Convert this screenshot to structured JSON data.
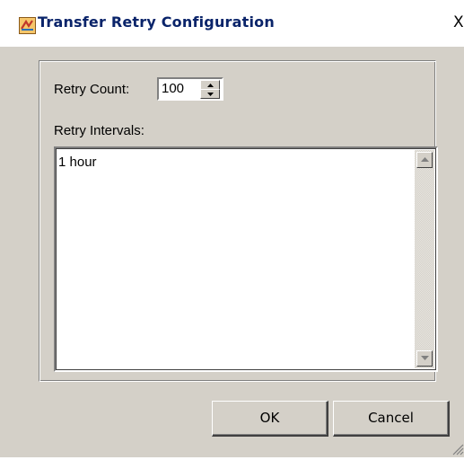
{
  "window": {
    "title": "Transfer Retry Configuration",
    "close_glyph": "X",
    "app_icon": "transfer-app-icon"
  },
  "retry_count": {
    "label": "Retry Count:",
    "value": "100"
  },
  "retry_intervals": {
    "label": "Retry Intervals:",
    "items": [
      "1 hour"
    ]
  },
  "buttons": {
    "ok_label": "OK",
    "cancel_label": "Cancel"
  },
  "colors": {
    "title_text": "#0a246a",
    "dialog_face": "#d4d0c8"
  }
}
